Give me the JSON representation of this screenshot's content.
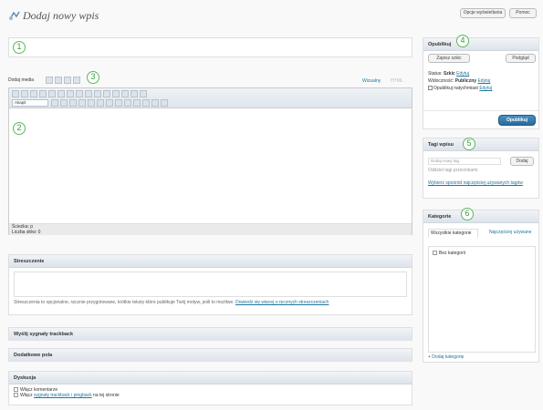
{
  "page": {
    "title": "Dodaj nowy wpis",
    "top_buttons": [
      "Opcje wyświetlania",
      "Pomoc"
    ]
  },
  "callouts": [
    "1",
    "2",
    "3",
    "4",
    "5",
    "6"
  ],
  "editor": {
    "upload_label": "Dodaj media",
    "tabs": [
      "Wizualny",
      "HTML"
    ],
    "format_select": "Akapit",
    "path_label": "Ścieżka: p",
    "word_count": "Liczba słów: 0"
  },
  "boxes": {
    "excerpt": {
      "title": "Streszczenie",
      "description": "Streszczenia to opcjonalne, ręcznie przygotowane, krótkie teksty które publikuje Twój motyw, jeśli to możliwe.",
      "link": "Dowiedz się więcej o ręcznych streszczeniach"
    },
    "trackbacks": {
      "title": "Wyślij sygnały trackback"
    },
    "custom_fields": {
      "title": "Dodatkowe pola"
    },
    "discussion": {
      "title": "Dyskusja",
      "allow_comments": "Włącz komentarze",
      "allow_pings_prefix": "Włącz ",
      "allow_pings_link": "sygnały trackback i pingback",
      "allow_pings_suffix": " na tej stronie"
    }
  },
  "publish": {
    "title": "Opublikuj",
    "save_draft": "Zapisz szkic",
    "preview": "Podgląd",
    "status_label": "Status:",
    "status_value": "Szkic",
    "status_edit": "Edytuj",
    "visibility_label": "Widoczność:",
    "visibility_value": "Publiczny",
    "visibility_edit": "Edytuj",
    "publish_now_label": "Opublikuj natychmiast",
    "publish_now_edit": "Edytuj",
    "publish_button": "Opublikuj"
  },
  "tags": {
    "title": "Tagi wpisu",
    "input_placeholder": "Dodaj nowy tag",
    "add_button": "Dodaj",
    "hint": "Oddziel tagi przecinkami",
    "choose_link": "Wybierz spośród najczęściej używanych tagów"
  },
  "categories": {
    "title": "Kategorie",
    "tabs": [
      "Wszystkie kategorie",
      "Najczęściej używane"
    ],
    "items": [
      "Bez kategorii"
    ],
    "add_link": "+ Dodaj kategorię"
  },
  "colors": {
    "accent_green": "#5cb85c",
    "link_blue": "#21759b",
    "panel_head": "#dde3ea"
  }
}
